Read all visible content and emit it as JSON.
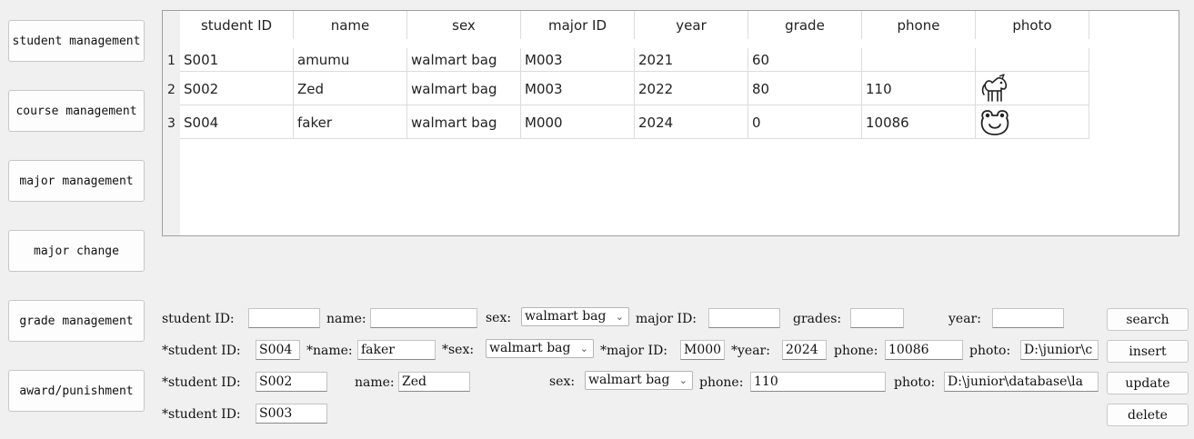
{
  "nav": {
    "student": "student management",
    "course": "course management",
    "major": "major management",
    "major_change": "major change",
    "grade": "grade management",
    "award": "award/punishment"
  },
  "table": {
    "headers": [
      "student ID",
      "name",
      "sex",
      "major ID",
      "year",
      "grade",
      "phone",
      "photo"
    ],
    "rows": [
      {
        "num": "1",
        "id": "S001",
        "name": "amumu",
        "sex": "walmart bag",
        "major": "M003",
        "year": "2021",
        "grade": "60",
        "phone": "",
        "photo": ""
      },
      {
        "num": "2",
        "id": "S002",
        "name": "Zed",
        "sex": "walmart bag",
        "major": "M003",
        "year": "2022",
        "grade": "80",
        "phone": "110",
        "photo": "unicorn"
      },
      {
        "num": "3",
        "id": "S004",
        "name": "faker",
        "sex": "walmart bag",
        "major": "M000",
        "year": "2024",
        "grade": "0",
        "phone": "10086",
        "photo": "frog"
      }
    ]
  },
  "search": {
    "student_id_label": "student ID:",
    "name_label": "name:",
    "sex_label": "sex:",
    "sex_value": "walmart bag",
    "major_label": "major ID:",
    "grades_label": "grades:",
    "year_label": "year:",
    "student_id": "",
    "name": "",
    "major": "",
    "grades": "",
    "year": "",
    "button": "search"
  },
  "insert": {
    "student_id_label": "*student ID:",
    "student_id": "S004",
    "name_label": "*name:",
    "name": "faker",
    "sex_label": "*sex:",
    "sex_value": "walmart bag",
    "major_label": "*major ID:",
    "major": "M000",
    "year_label": "*year:",
    "year": "2024",
    "phone_label": "phone:",
    "phone": "10086",
    "photo_label": "photo:",
    "photo": "D:\\junior\\c",
    "button": "insert"
  },
  "update": {
    "student_id_label": "*student ID:",
    "student_id": "S002",
    "name_label": "name:",
    "name": "Zed",
    "sex_label": "sex:",
    "sex_value": "walmart bag",
    "phone_label": "phone:",
    "phone": "110",
    "photo_label": "photo:",
    "photo": "D:\\junior\\database\\la",
    "button": "update"
  },
  "delete": {
    "student_id_label": "*student ID:",
    "student_id": "S003",
    "button": "delete"
  }
}
